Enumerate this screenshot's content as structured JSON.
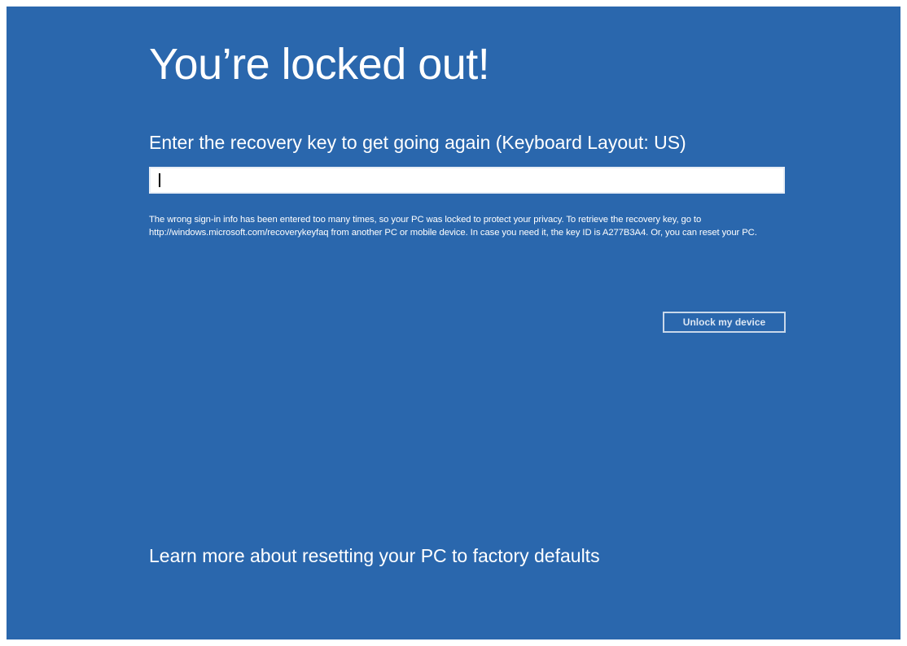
{
  "screen": {
    "title": "You’re locked out!",
    "prompt": "Enter the recovery key to get going again (Keyboard Layout: US)",
    "recovery_key_input": {
      "value": "",
      "placeholder": ""
    },
    "info_text": "The wrong sign-in info has been entered too many times, so your PC was locked to protect your privacy. To retrieve the recovery key, go to http://windows.microsoft.com/recoverykeyfaq from another PC or mobile device. In case you need it, the key ID is A277B3A4.  Or, you can reset your PC.",
    "unlock_button_label": "Unlock my device",
    "learn_more_link": "Learn more about resetting your PC to factory defaults"
  },
  "colors": {
    "background": "#2a67ad",
    "text": "#ffffff",
    "input_background": "#ffffff"
  }
}
